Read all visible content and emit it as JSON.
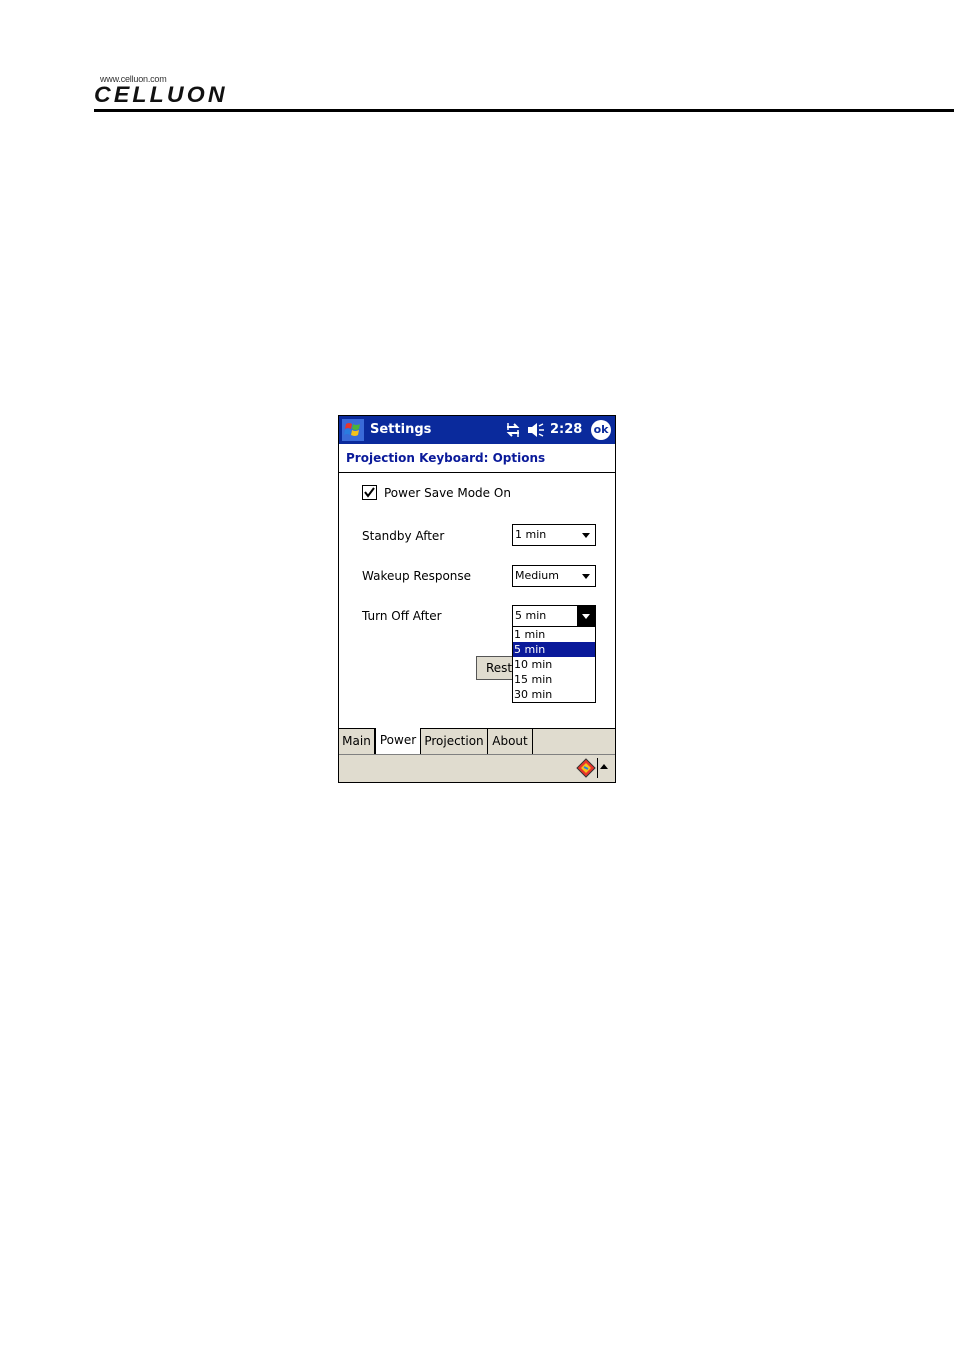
{
  "page_header": {
    "logo_url": "www.celluon.com",
    "logo_word": "CELLUON"
  },
  "device": {
    "titlebar": {
      "title": "Settings",
      "clock": "2:28",
      "ok_label": "ok",
      "color": "#0a2a9c"
    },
    "subheader": "Projection Keyboard: Options",
    "power_save": {
      "label": "Power Save Mode On",
      "checked": true
    },
    "standby": {
      "label": "Standby After",
      "value": "1 min"
    },
    "wakeup": {
      "label": "Wakeup Response",
      "value": "Medium"
    },
    "turn_off": {
      "label": "Turn Off After",
      "value": "5 min",
      "options": [
        "1 min",
        "5 min",
        "10 min",
        "15 min",
        "30 min"
      ],
      "selected_index": 1
    },
    "restore_button": "Rest",
    "tabs": [
      "Main",
      "Power",
      "Projection",
      "About"
    ],
    "active_tab": "Power",
    "selection_color": "#0a1a9a"
  }
}
